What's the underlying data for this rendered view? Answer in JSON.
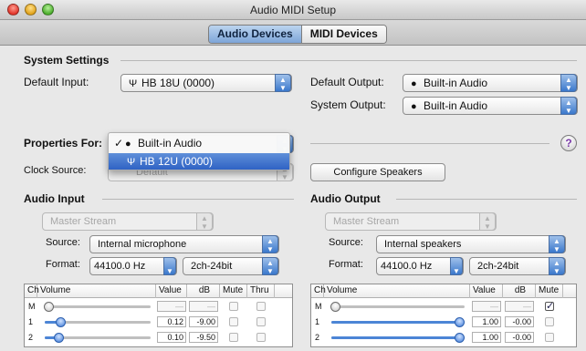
{
  "window": {
    "title": "Audio MIDI Setup"
  },
  "tabs": [
    {
      "label": "Audio Devices",
      "active": true
    },
    {
      "label": "MIDI Devices",
      "active": false
    }
  ],
  "system_settings": {
    "heading": "System Settings",
    "default_input_label": "Default Input:",
    "default_input_value": "HB 18U (0000)",
    "default_output_label": "Default Output:",
    "default_output_value": "Built-in Audio",
    "system_output_label": "System Output:",
    "system_output_value": "Built-in Audio"
  },
  "properties": {
    "label": "Properties For:",
    "menu_items": [
      {
        "label": "Built-in Audio",
        "checked": true,
        "highlighted": false
      },
      {
        "label": "HB 12U (0000)",
        "checked": false,
        "highlighted": true
      }
    ],
    "clock_source_label": "Clock Source:",
    "clock_source_value": "Default",
    "configure_speakers_label": "Configure Speakers",
    "help_label": "?"
  },
  "audio_input": {
    "heading": "Audio Input",
    "stream": "Master Stream",
    "source_label": "Source:",
    "source_value": "Internal microphone",
    "format_label": "Format:",
    "format_rate": "44100.0 Hz",
    "format_bits": "2ch-24bit",
    "columns": [
      "Ch",
      "Volume",
      "Value",
      "dB",
      "Mute",
      "Thru"
    ],
    "rows": [
      {
        "ch": "M",
        "value": "—",
        "db": "—",
        "level": 0.0,
        "mute": false,
        "thru": false
      },
      {
        "ch": "1",
        "value": "0.12",
        "db": "-9.00",
        "level": 0.12,
        "mute": false,
        "thru": false
      },
      {
        "ch": "2",
        "value": "0.10",
        "db": "-9.50",
        "level": 0.1,
        "mute": false,
        "thru": false
      }
    ]
  },
  "audio_output": {
    "heading": "Audio Output",
    "stream": "Master Stream",
    "source_label": "Source:",
    "source_value": "Internal speakers",
    "format_label": "Format:",
    "format_rate": "44100.0 Hz",
    "format_bits": "2ch-24bit",
    "columns": [
      "Ch",
      "Volume",
      "Value",
      "dB",
      "Mute"
    ],
    "rows": [
      {
        "ch": "M",
        "value": "—",
        "db": "—",
        "level": 0.0,
        "mute": true
      },
      {
        "ch": "1",
        "value": "1.00",
        "db": "-0.00",
        "level": 1.0,
        "mute": false
      },
      {
        "ch": "2",
        "value": "1.00",
        "db": "-0.00",
        "level": 1.0,
        "mute": false
      }
    ]
  },
  "colors": {
    "accent": "#3a78cc",
    "highlight": "#2f62c4",
    "help": "#7a3aa8"
  }
}
